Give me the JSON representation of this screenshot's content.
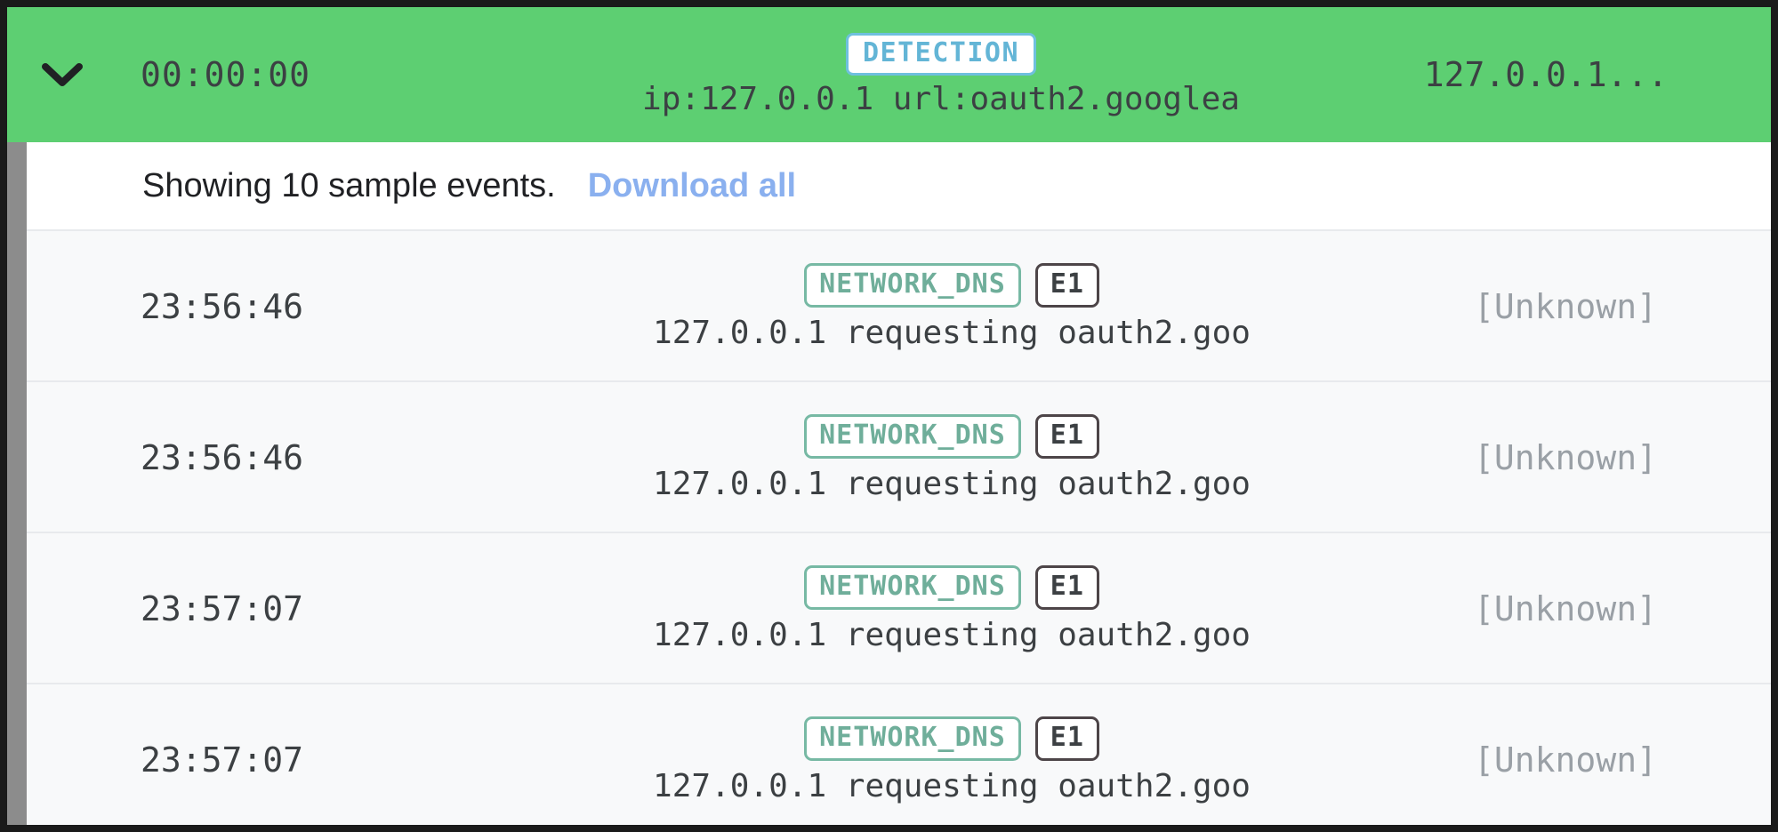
{
  "colors": {
    "detection_green": "#5dcf72",
    "detection_badge_border": "#6fc0de",
    "detection_badge_text": "#63b5d6",
    "event_badge_border": "#77b9a4",
    "event_badge_text": "#6fae9a",
    "event_id_border": "#4d4548",
    "link_blue": "#8ab0ef",
    "row_background": "#f8f9fa",
    "unknown_text": "#9aa0a6",
    "left_rail": "#8c8c8c"
  },
  "detection_header": {
    "expand_icon": "chevron-down-icon",
    "time": "00:00:00",
    "badge": "DETECTION",
    "description": "ip:127.0.0.1 url:oauth2.googlea",
    "source": "127.0.0.1..."
  },
  "notice": {
    "text": "Showing 10 sample events.",
    "download_link": "Download all"
  },
  "events": [
    {
      "time": "23:56:46",
      "type": "NETWORK_DNS",
      "event_id": "E1",
      "description": "127.0.0.1 requesting oauth2.goo",
      "source": "[Unknown]"
    },
    {
      "time": "23:56:46",
      "type": "NETWORK_DNS",
      "event_id": "E1",
      "description": "127.0.0.1 requesting oauth2.goo",
      "source": "[Unknown]"
    },
    {
      "time": "23:57:07",
      "type": "NETWORK_DNS",
      "event_id": "E1",
      "description": "127.0.0.1 requesting oauth2.goo",
      "source": "[Unknown]"
    },
    {
      "time": "23:57:07",
      "type": "NETWORK_DNS",
      "event_id": "E1",
      "description": "127.0.0.1 requesting oauth2.goo",
      "source": "[Unknown]"
    }
  ]
}
